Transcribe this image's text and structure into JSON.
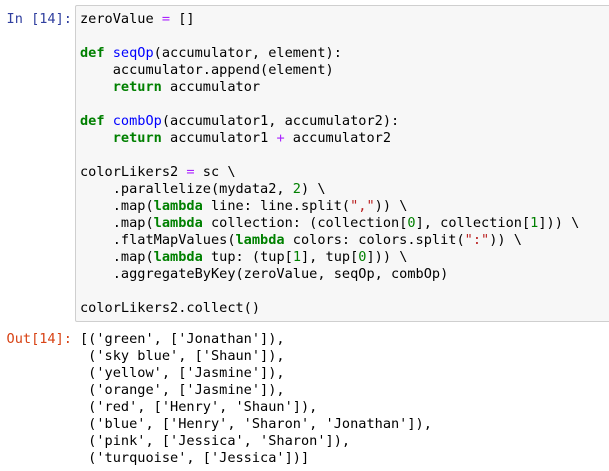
{
  "cell": {
    "in_prompt": "In [14]:",
    "out_prompt": "Out[14]:"
  },
  "code_lines": [
    [
      {
        "t": "zeroValue "
      },
      {
        "t": "=",
        "c": "o"
      },
      {
        "t": " []"
      }
    ],
    [],
    [
      {
        "t": "def",
        "c": "k"
      },
      {
        "t": " "
      },
      {
        "t": "seqOp",
        "c": "f"
      },
      {
        "t": "(accumulator, element):"
      }
    ],
    [
      {
        "t": "    accumulator.append(element)"
      }
    ],
    [
      {
        "t": "    "
      },
      {
        "t": "return",
        "c": "k"
      },
      {
        "t": " accumulator"
      }
    ],
    [],
    [
      {
        "t": "def",
        "c": "k"
      },
      {
        "t": " "
      },
      {
        "t": "combOp",
        "c": "f"
      },
      {
        "t": "(accumulator1, accumulator2):"
      }
    ],
    [
      {
        "t": "    "
      },
      {
        "t": "return",
        "c": "k"
      },
      {
        "t": " accumulator1 "
      },
      {
        "t": "+",
        "c": "o"
      },
      {
        "t": " accumulator2"
      }
    ],
    [],
    [
      {
        "t": "colorLikers2 "
      },
      {
        "t": "=",
        "c": "o"
      },
      {
        "t": " sc \\"
      }
    ],
    [
      {
        "t": "    .parallelize(mydata2, "
      },
      {
        "t": "2",
        "c": "n"
      },
      {
        "t": ") \\"
      }
    ],
    [
      {
        "t": "    .map("
      },
      {
        "t": "lambda",
        "c": "k"
      },
      {
        "t": " line: line.split("
      },
      {
        "t": "\",\"",
        "c": "s"
      },
      {
        "t": ")) \\"
      }
    ],
    [
      {
        "t": "    .map("
      },
      {
        "t": "lambda",
        "c": "k"
      },
      {
        "t": " collection: (collection["
      },
      {
        "t": "0",
        "c": "n"
      },
      {
        "t": "], collection["
      },
      {
        "t": "1",
        "c": "n"
      },
      {
        "t": "])) \\"
      }
    ],
    [
      {
        "t": "    .flatMapValues("
      },
      {
        "t": "lambda",
        "c": "k"
      },
      {
        "t": " colors: colors.split("
      },
      {
        "t": "\":\"",
        "c": "s"
      },
      {
        "t": ")) \\"
      }
    ],
    [
      {
        "t": "    .map("
      },
      {
        "t": "lambda",
        "c": "k"
      },
      {
        "t": " tup: (tup["
      },
      {
        "t": "1",
        "c": "n"
      },
      {
        "t": "], tup["
      },
      {
        "t": "0",
        "c": "n"
      },
      {
        "t": "])) \\"
      }
    ],
    [
      {
        "t": "    .aggregateByKey(zeroValue, seqOp, combOp)"
      }
    ],
    [],
    [
      {
        "t": "colorLikers2.collect()"
      }
    ]
  ],
  "output_lines": [
    "[('green', ['Jonathan']),",
    " ('sky blue', ['Shaun']),",
    " ('yellow', ['Jasmine']),",
    " ('orange', ['Jasmine']),",
    " ('red', ['Henry', 'Shaun']),",
    " ('blue', ['Henry', 'Sharon', 'Jonathan']),",
    " ('pink', ['Jessica', 'Sharon']),",
    " ('turquoise', ['Jessica'])]"
  ]
}
